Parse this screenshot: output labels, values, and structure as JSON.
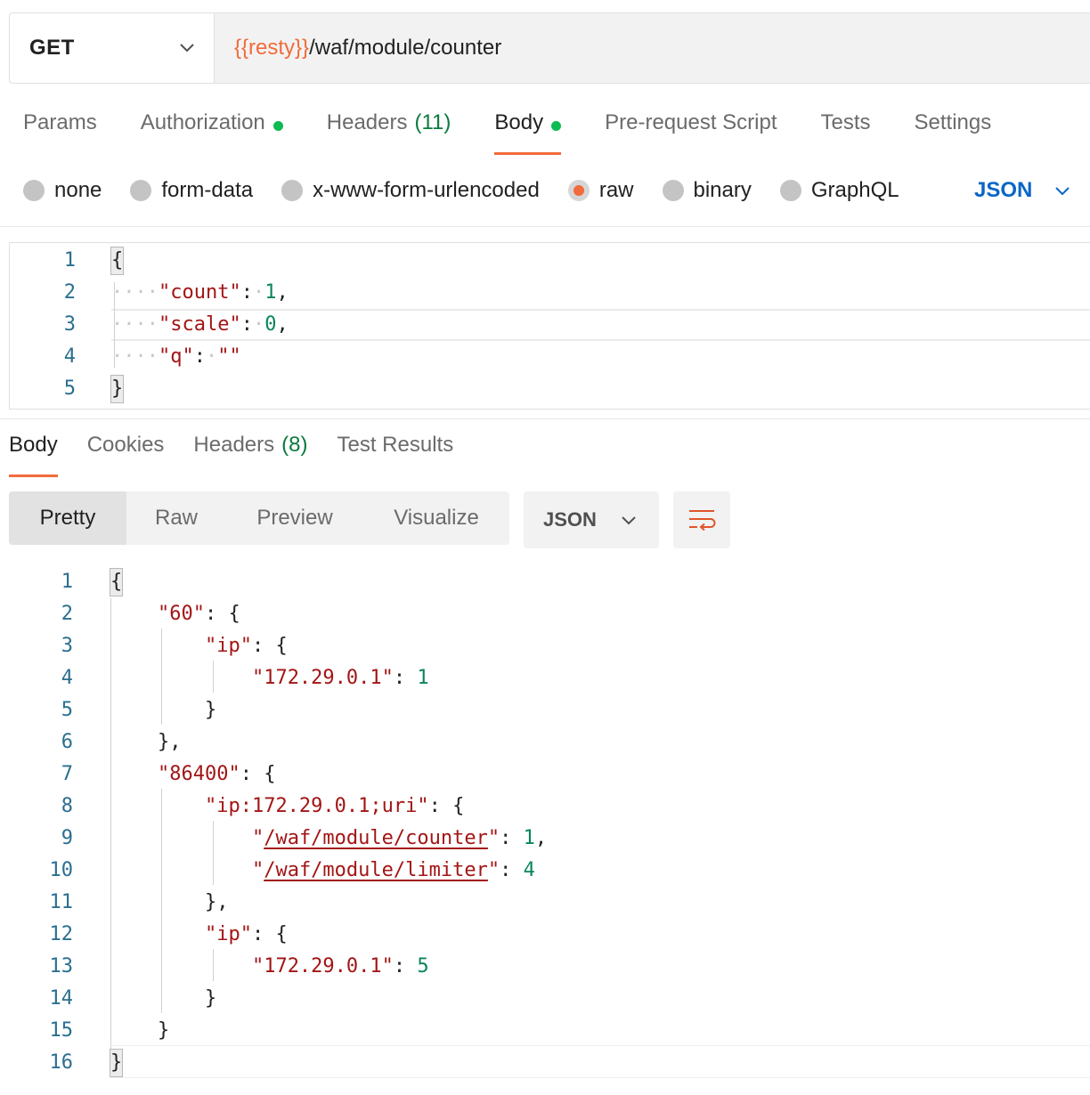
{
  "request": {
    "method": "GET",
    "url_variable": "{{resty}}",
    "url_path": "/waf/module/counter"
  },
  "request_tabs": [
    {
      "label": "Params"
    },
    {
      "label": "Authorization",
      "dot": true
    },
    {
      "label": "Headers",
      "count": "(11)"
    },
    {
      "label": "Body",
      "dot": true,
      "active": true
    },
    {
      "label": "Pre-request Script"
    },
    {
      "label": "Tests"
    },
    {
      "label": "Settings"
    }
  ],
  "body_types": [
    {
      "label": "none"
    },
    {
      "label": "form-data"
    },
    {
      "label": "x-www-form-urlencoded"
    },
    {
      "label": "raw",
      "checked": true
    },
    {
      "label": "binary"
    },
    {
      "label": "GraphQL"
    }
  ],
  "body_language": "JSON",
  "request_body_lines": [
    "1",
    "2",
    "3",
    "4",
    "5"
  ],
  "request_body": {
    "key1": "\"count\"",
    "val1": "1",
    "key2": "\"scale\"",
    "val2": "0",
    "key3": "\"q\"",
    "val3": "\"\""
  },
  "response_tabs": [
    {
      "label": "Body",
      "active": true
    },
    {
      "label": "Cookies"
    },
    {
      "label": "Headers",
      "count": "(8)"
    },
    {
      "label": "Test Results"
    }
  ],
  "view_modes": [
    "Pretty",
    "Raw",
    "Preview",
    "Visualize"
  ],
  "response_format": "JSON",
  "response_body": {
    "k60": "\"60\"",
    "kip": "\"ip\"",
    "kaddr": "\"172.29.0.1\"",
    "v60": "1",
    "k86400": "\"86400\"",
    "kipuri": "\"ip:172.29.0.1;uri\"",
    "kcounter": "/waf/module/counter",
    "vcounter": "1",
    "klimiter": "/waf/module/limiter",
    "vlimiter": "4",
    "vaddr2": "5"
  },
  "colors": {
    "accent": "#f26b3a",
    "dot_green": "#0cbb52",
    "json_blue": "#0a66c7",
    "key_red": "#a31515",
    "number_green": "#098658"
  }
}
